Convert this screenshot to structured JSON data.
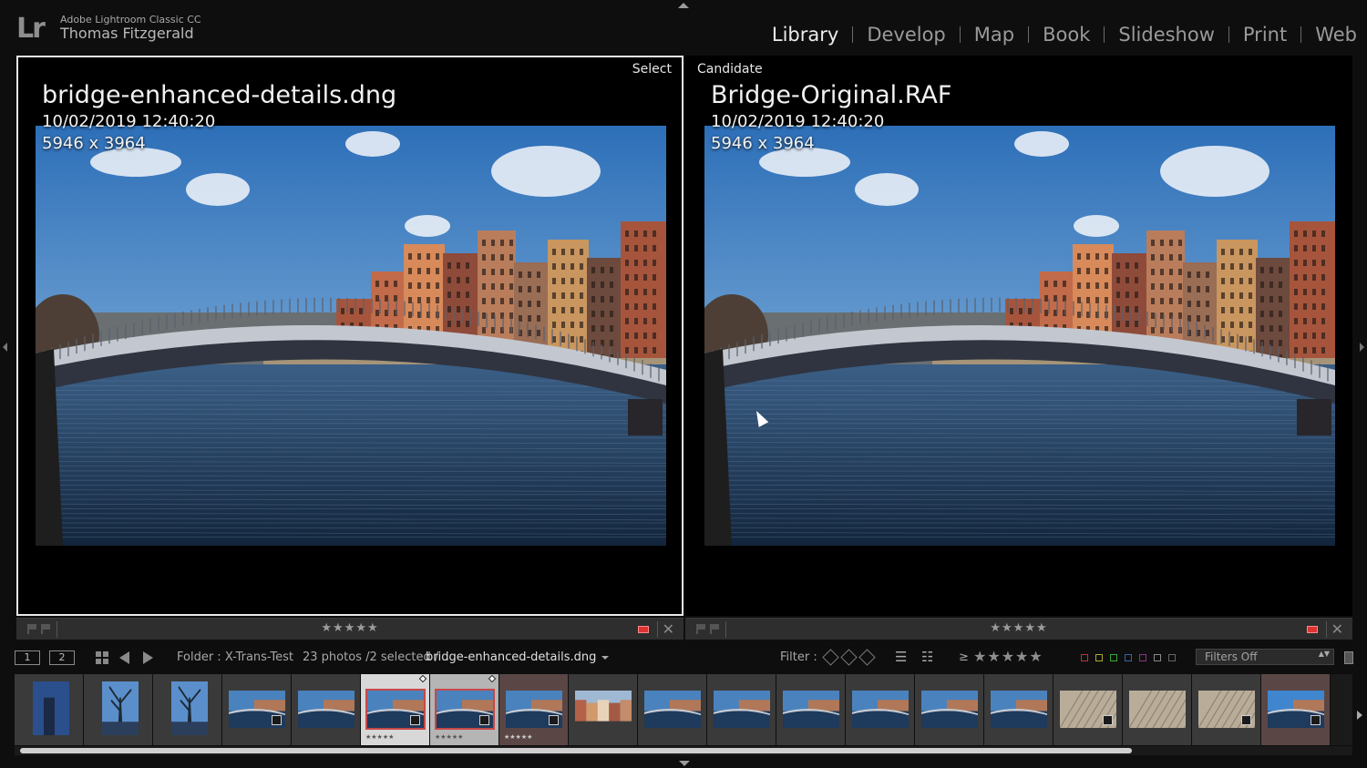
{
  "identity": {
    "logo": "Lr",
    "app_name": "Adobe Lightroom Classic CC",
    "user_name": "Thomas Fitzgerald"
  },
  "modules": [
    "Library",
    "Develop",
    "Map",
    "Book",
    "Slideshow",
    "Print",
    "Web"
  ],
  "active_module": "Library",
  "compare": {
    "select": {
      "label": "Select",
      "filename": "bridge-enhanced-details.dng",
      "datetime": "10/02/2019 12:40:20",
      "dimensions": "5946 x 3964",
      "stars": "★★★★★"
    },
    "candidate": {
      "label": "Candidate",
      "filename": "Bridge-Original.RAF",
      "datetime": "10/02/2019 12:40:20",
      "dimensions": "5946 x 3964",
      "stars": "★★★★★"
    },
    "close_glyph": "✕"
  },
  "filmstrip_bar": {
    "screen1": "1",
    "screen2": "2",
    "source": "Folder : X-Trans-Test",
    "count": "23 photos /2 selected /",
    "current_file": "bridge-enhanced-details.dng",
    "filter_label": "Filter :",
    "rating_op": "≥",
    "rating_stars": "★★★★★",
    "filters_preset": "Filters Off",
    "updown": "▲▼"
  },
  "filmstrip": {
    "thumb_stars": "★★★★★",
    "items": [
      {
        "type": "portrait-blue"
      },
      {
        "type": "portrait-tree"
      },
      {
        "type": "portrait-tree"
      },
      {
        "type": "bridge",
        "badge": true
      },
      {
        "type": "bridge"
      },
      {
        "type": "bridge",
        "badge": true,
        "state": "selected",
        "stars": true,
        "red": true
      },
      {
        "type": "bridge",
        "badge": true,
        "state": "selected2",
        "stars": true,
        "red": true
      },
      {
        "type": "bridge",
        "badge": true,
        "state": "pinkish",
        "stars": true
      },
      {
        "type": "buildings"
      },
      {
        "type": "bridge"
      },
      {
        "type": "bridge"
      },
      {
        "type": "bridge"
      },
      {
        "type": "bridge"
      },
      {
        "type": "bridge"
      },
      {
        "type": "bridge"
      },
      {
        "type": "texture",
        "badge": true
      },
      {
        "type": "texture"
      },
      {
        "type": "texture",
        "badge": true
      },
      {
        "type": "bridge-bright",
        "badge": true,
        "state": "pinkish"
      }
    ]
  },
  "colors": {
    "accent": "#e8e8e8",
    "reject_label": "#dd3333",
    "selection_border": "#c74848"
  }
}
